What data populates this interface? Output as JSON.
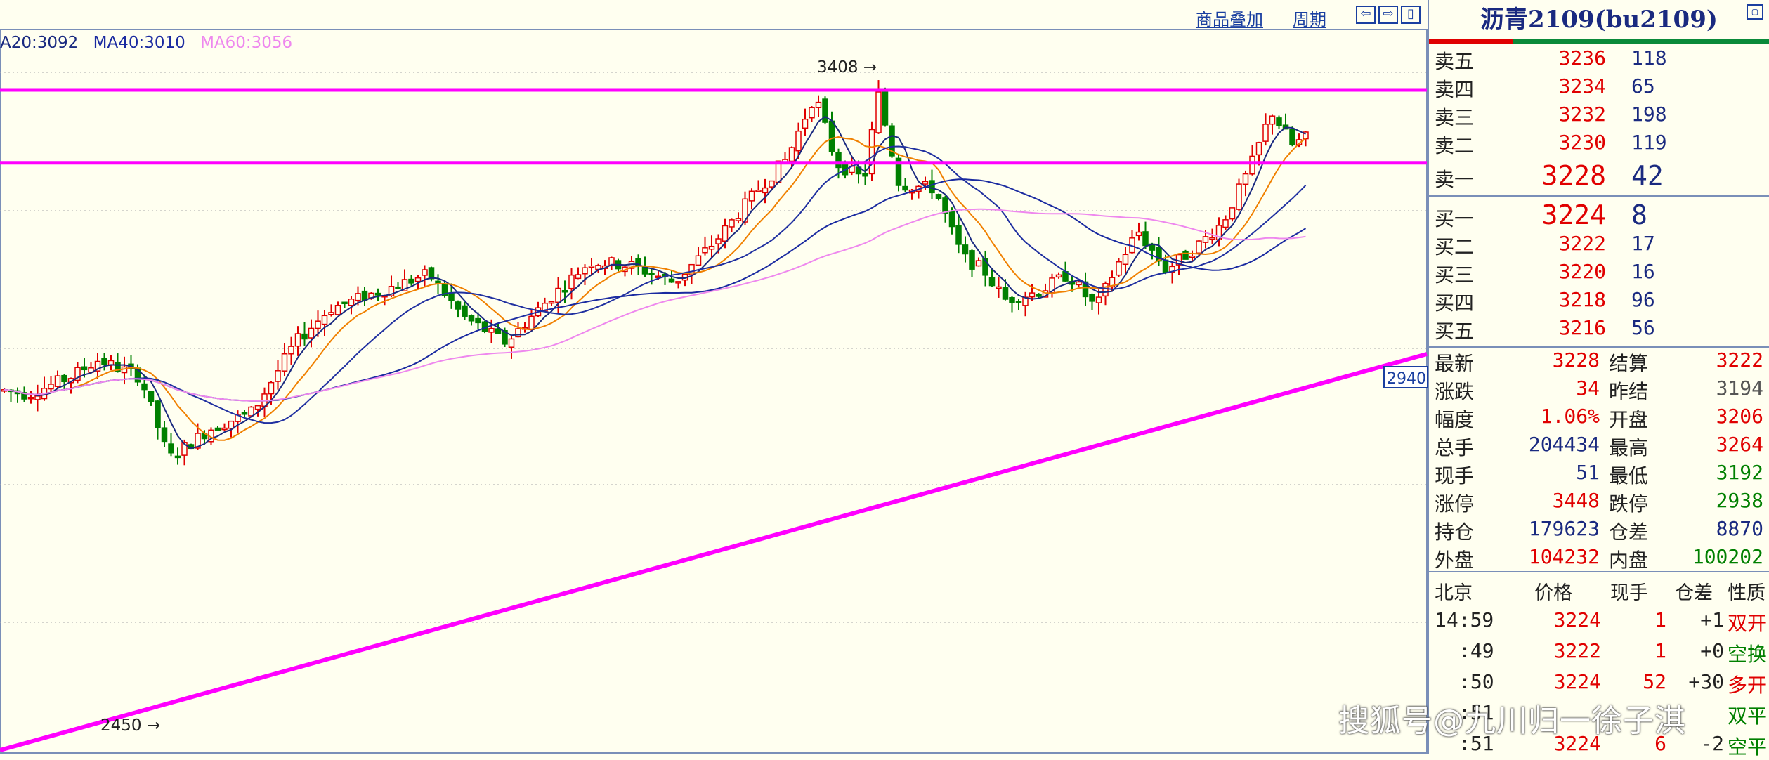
{
  "toolbar": {
    "overlay_label": "商品叠加",
    "period_label": "周期",
    "nav_buttons": [
      "⇦",
      "⇨",
      "▯"
    ]
  },
  "ma_legend": {
    "ma20": "A20:3092",
    "ma40": "MA40:3010",
    "ma60": "MA60:3056"
  },
  "chart_data": {
    "type": "candlestick",
    "annotations": [
      {
        "text": "3408",
        "value": 3408
      },
      {
        "text": "2450",
        "value": 2450
      },
      {
        "text": "2940",
        "value": 2940
      }
    ],
    "resistance_lines": [
      3310,
      3140
    ],
    "colors": {
      "up": "#e00000",
      "down": "#008000",
      "resistance": "#ff00ff",
      "trendline": "#ff00ff",
      "ma_short": "#1a2a80",
      "ma_orange": "#f08000",
      "ma40": "#1a2aa0",
      "ma60": "#ee88ee"
    }
  },
  "quote": {
    "title": "沥青2109(bu2109)",
    "close_icon": "window-restore-icon",
    "asks": [
      {
        "label": "卖五",
        "price": "3236",
        "vol": "118"
      },
      {
        "label": "卖四",
        "price": "3234",
        "vol": "65"
      },
      {
        "label": "卖三",
        "price": "3232",
        "vol": "198"
      },
      {
        "label": "卖二",
        "price": "3230",
        "vol": "119"
      },
      {
        "label": "卖一",
        "price": "3228",
        "vol": "42"
      }
    ],
    "bids": [
      {
        "label": "买一",
        "price": "3224",
        "vol": "8"
      },
      {
        "label": "买二",
        "price": "3222",
        "vol": "17"
      },
      {
        "label": "买三",
        "price": "3220",
        "vol": "16"
      },
      {
        "label": "买四",
        "price": "3218",
        "vol": "96"
      },
      {
        "label": "买五",
        "price": "3216",
        "vol": "56"
      }
    ],
    "stats": [
      {
        "k1": "最新",
        "v1": "3228",
        "c1": "#e00000",
        "k2": "结算",
        "v2": "3222",
        "c2": "#e00000"
      },
      {
        "k1": "涨跌",
        "v1": "34",
        "c1": "#e00000",
        "k2": "昨结",
        "v2": "3194",
        "c2": "#555555"
      },
      {
        "k1": "幅度",
        "v1": "1.06%",
        "c1": "#e00000",
        "k2": "开盘",
        "v2": "3206",
        "c2": "#e00000"
      },
      {
        "k1": "总手",
        "v1": "204434",
        "c1": "#1a2a80",
        "k2": "最高",
        "v2": "3264",
        "c2": "#e00000"
      },
      {
        "k1": "现手",
        "v1": "51",
        "c1": "#1a2a80",
        "k2": "最低",
        "v2": "3192",
        "c2": "#008000"
      },
      {
        "k1": "涨停",
        "v1": "3448",
        "c1": "#e00000",
        "k2": "跌停",
        "v2": "2938",
        "c2": "#008000"
      },
      {
        "k1": "持仓",
        "v1": "179623",
        "c1": "#1a2a80",
        "k2": "仓差",
        "v2": "8870",
        "c2": "#1a2a80"
      },
      {
        "k1": "外盘",
        "v1": "104232",
        "c1": "#e00000",
        "k2": "内盘",
        "v2": "100202",
        "c2": "#008000"
      }
    ],
    "tick_headers": [
      "北京",
      "价格",
      "现手",
      "仓差",
      "性质"
    ],
    "ticks": [
      {
        "time": "14:59",
        "price": "3224",
        "vol": "1",
        "oi": "+1",
        "nature": "双开",
        "nc": "#e00000"
      },
      {
        "time": ":49",
        "price": "3222",
        "vol": "1",
        "oi": "+0",
        "nature": "空换",
        "nc": "#008000"
      },
      {
        "time": ":50",
        "price": "3224",
        "vol": "52",
        "oi": "+30",
        "nature": "多开",
        "nc": "#e00000"
      },
      {
        "time": ":51",
        "price": "",
        "vol": "",
        "oi": "",
        "nature": "双平",
        "nc": "#008000"
      },
      {
        "time": ":51",
        "price": "3224",
        "vol": "6",
        "oi": "-2",
        "nature": "空平",
        "nc": "#008000"
      }
    ]
  },
  "watermark": "搜狐号@九川归一徐子淇"
}
